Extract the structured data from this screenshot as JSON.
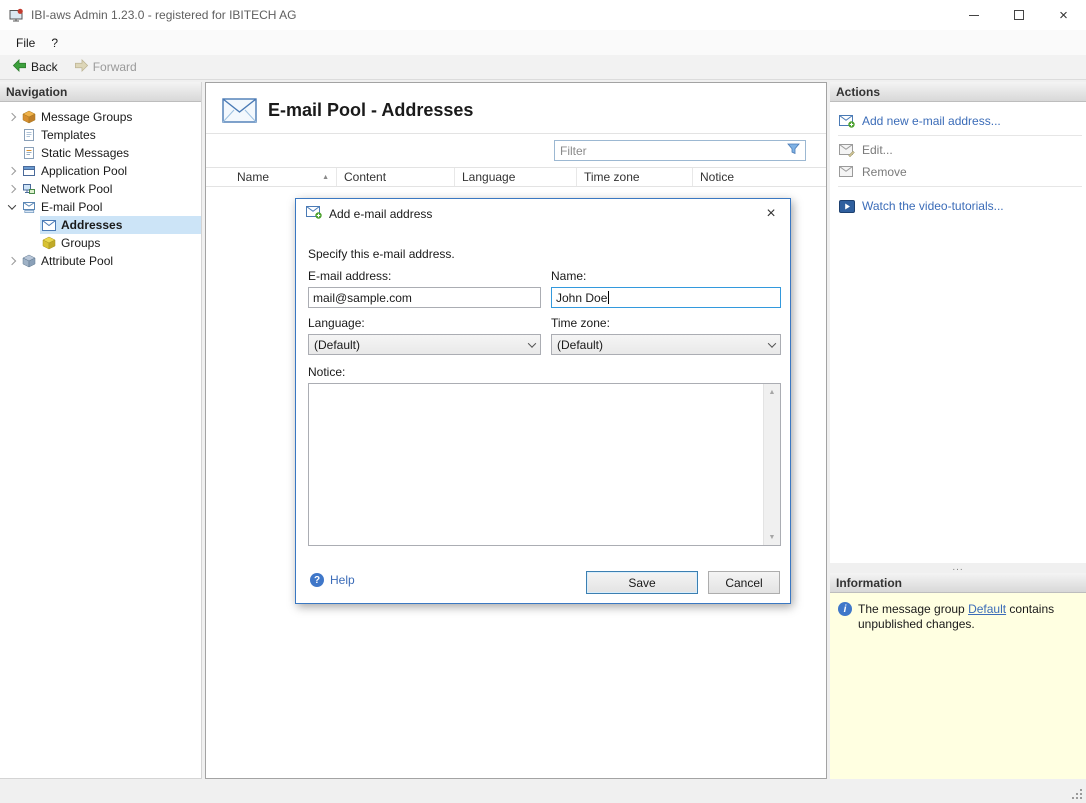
{
  "window": {
    "title": "IBI-aws Admin 1.23.0 - registered for IBITECH AG"
  },
  "glyphs": {
    "close": "×",
    "sort_asc": "▲",
    "scroll_up": "▲",
    "scroll_down": "▼",
    "dots": "..."
  },
  "menubar": {
    "items": [
      {
        "label": "File"
      },
      {
        "label": "?"
      }
    ]
  },
  "toolbar": {
    "back_label": "Back",
    "forward_label": "Forward"
  },
  "navigation": {
    "header": "Navigation",
    "items": [
      {
        "label": "Message Groups"
      },
      {
        "label": "Templates"
      },
      {
        "label": "Static Messages"
      },
      {
        "label": "Application Pool"
      },
      {
        "label": "Network Pool"
      },
      {
        "label": "E-mail Pool"
      },
      {
        "label": "Addresses"
      },
      {
        "label": "Groups"
      },
      {
        "label": "Attribute Pool"
      }
    ]
  },
  "main": {
    "page_title": "E-mail Pool - Addresses",
    "filter_placeholder": "Filter",
    "table_columns": [
      "Name",
      "Content",
      "Language",
      "Time zone",
      "Notice"
    ]
  },
  "actions_panel": {
    "header": "Actions",
    "items": [
      {
        "label": "Add new e-mail address...",
        "enabled": true
      },
      {
        "label": "Edit...",
        "enabled": false
      },
      {
        "label": "Remove",
        "enabled": false
      },
      {
        "label": "Watch the video-tutorials...",
        "enabled": true
      }
    ]
  },
  "information_panel": {
    "header": "Information",
    "message_prefix": "The message group ",
    "message_link": "Default",
    "message_suffix": " contains unpublished changes."
  },
  "dialog": {
    "title": "Add e-mail address",
    "description": "Specify this e-mail address.",
    "email_label": "E-mail address:",
    "email_value": "mail@sample.com",
    "name_label": "Name:",
    "name_value": "John Doe",
    "language_label": "Language:",
    "language_value": "(Default)",
    "timezone_label": "Time zone:",
    "timezone_value": "(Default)",
    "notice_label": "Notice:",
    "help_label": "Help",
    "save_label": "Save",
    "cancel_label": "Cancel"
  },
  "colors": {
    "link_blue": "#3b6cb8",
    "selection": "#cce4f7",
    "info_bg": "#ffffe1",
    "dialog_border": "#3a78c2"
  }
}
